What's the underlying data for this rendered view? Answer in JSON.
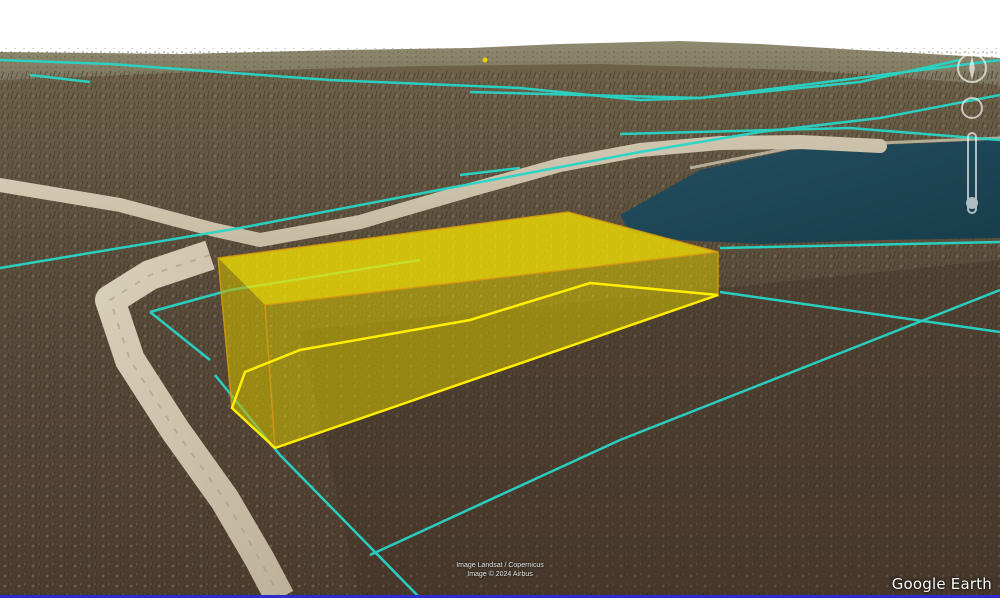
{
  "app": {
    "name": "Google Earth",
    "view_mode": "3D tilted view"
  },
  "map": {
    "terrain": [
      "hillside forest",
      "ridge",
      "gravel road",
      "lake"
    ],
    "layers": [
      {
        "name": "parcel-boundaries",
        "color": "#27d6c8"
      },
      {
        "name": "extruded-parcel-volume",
        "color": "#f2e000"
      }
    ],
    "highlight_color": "#f2e000",
    "water_color": "#1b4a5a"
  },
  "attribution": {
    "line1": "Image Landsat / Copernicus",
    "line2": "Image © 2024 Airbus"
  },
  "brand": "Google Earth",
  "controls": {
    "navigation": [
      "compass-icon",
      "tilt-icon",
      "zoom-slider"
    ]
  }
}
